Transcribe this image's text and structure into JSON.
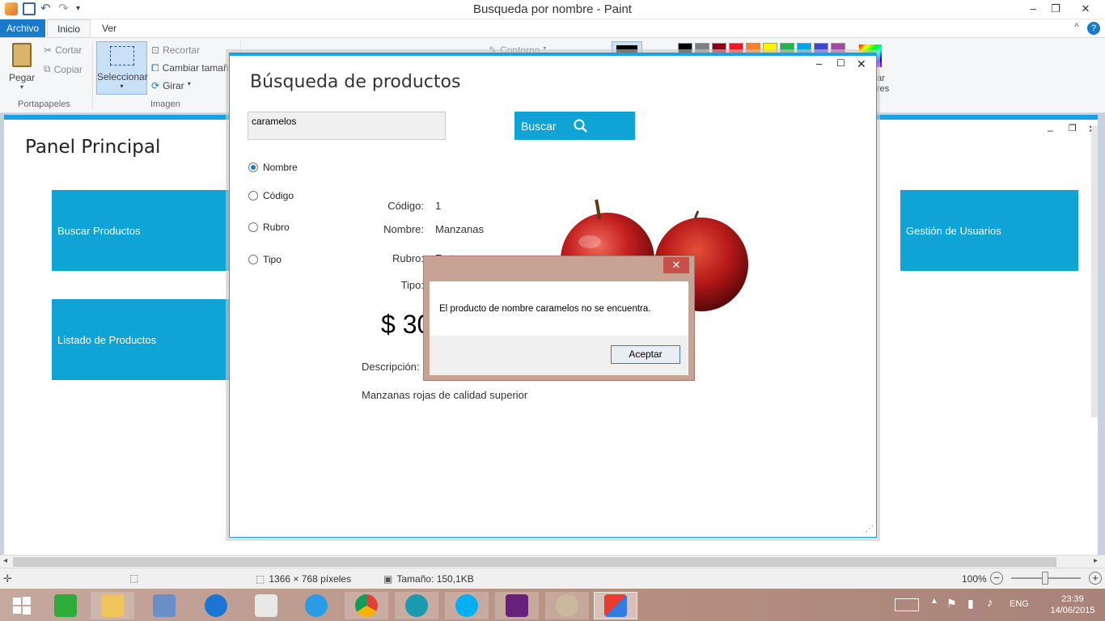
{
  "window": {
    "title": "Busqueda por nombre - Paint",
    "minimize": "–",
    "maximize": "❐",
    "close": "✕",
    "help": "?",
    "collapse": "^"
  },
  "ribbon": {
    "tabs": [
      "Archivo",
      "Inicio",
      "Ver"
    ],
    "clipboard": {
      "paste": "Pegar",
      "cut": "Cortar",
      "copy": "Copiar",
      "group": "Portapapeles"
    },
    "image": {
      "select": "Seleccionar",
      "crop": "Recortar",
      "resize": "Cambiar tamañ",
      "rotate": "Girar",
      "group": "Imagen"
    },
    "shapes": {
      "outline": "Contorno"
    },
    "colors_right": {
      "edit_colors_1": "ar",
      "edit_colors_2": "res"
    },
    "palette": [
      "#000000",
      "#7f7f7f",
      "#880015",
      "#ed1c24",
      "#ff7f27",
      "#fff200",
      "#22b14c",
      "#00a2e8",
      "#3f48cc",
      "#a349a4"
    ]
  },
  "main_panel": {
    "title": "Panel Principal",
    "tiles": {
      "buscar": "Buscar Productos",
      "listado": "Listado de Productos",
      "usuarios": "Gestión de Usuarios"
    }
  },
  "search_window": {
    "title": "Búsqueda de productos",
    "search_value": "caramelos",
    "search_button": "Buscar",
    "radios": [
      {
        "label": "Nombre",
        "selected": true
      },
      {
        "label": "Código",
        "selected": false
      },
      {
        "label": "Rubro",
        "selected": false
      },
      {
        "label": "Tipo",
        "selected": false
      }
    ],
    "fields": {
      "codigo_label": "Código:",
      "codigo_value": "1",
      "nombre_label": "Nombre:",
      "nombre_value": "Manzanas",
      "rubro_label": "Rubro:",
      "rubro_value": "Frutas",
      "tipo_label": "Tipo:",
      "price": "$ 30",
      "descripcion_label": "Descripción:",
      "descripcion_value": "Manzanas rojas de calidad superior"
    }
  },
  "message_box": {
    "text": "El producto de nombre caramelos no se encuentra.",
    "ok": "Aceptar",
    "close": "✕"
  },
  "statusbar": {
    "dimensions": "1366 × 768 píxeles",
    "size": "Tamaño: 150,1KB",
    "zoom": "100%"
  },
  "taskbar": {
    "lang": "ENG",
    "time": "23:39",
    "date": "14/06/2015"
  }
}
